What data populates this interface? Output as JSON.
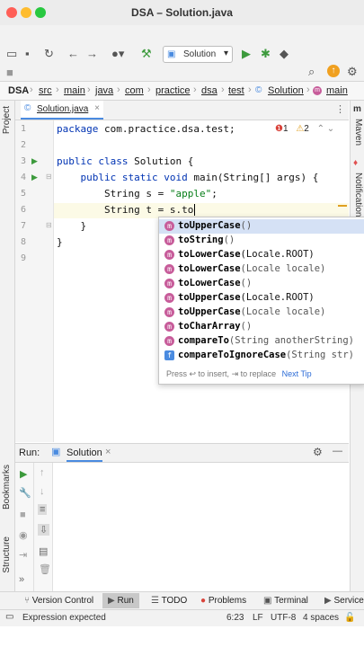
{
  "window": {
    "title": "DSA – Solution.java"
  },
  "toolbar": {
    "run_config": "Solution"
  },
  "breadcrumb": [
    "DSA",
    "src",
    "main",
    "java",
    "com",
    "practice",
    "dsa",
    "test",
    "Solution",
    "main"
  ],
  "left_strip": {
    "project": "Project",
    "bookmarks": "Bookmarks",
    "structure": "Structure"
  },
  "right_strip": {
    "maven": "Maven",
    "notifications": "Notifications"
  },
  "editor": {
    "tab": "Solution.java",
    "line_numbers": [
      "1",
      "2",
      "3",
      "4",
      "5",
      "6",
      "7",
      "8",
      "9"
    ],
    "lines": [
      {
        "kw": "package",
        "rest": " com.practice.dsa.test;"
      },
      {
        "kw": "",
        "rest": ""
      },
      {
        "kw": "public class",
        "rest": " Solution {"
      },
      {
        "kw": "    public static void",
        "rest": " main(String[] args) {"
      },
      {
        "kw": "",
        "rest": "        String s = ",
        "str": "\"apple\"",
        "tail": ";"
      },
      {
        "kw": "",
        "rest": "        String t = s.to"
      },
      {
        "kw": "",
        "rest": "    }"
      },
      {
        "kw": "",
        "rest": "}"
      },
      {
        "kw": "",
        "rest": ""
      }
    ],
    "errors": "1",
    "warnings": "2"
  },
  "completion": {
    "items": [
      {
        "name": "toUpperCase",
        "params": "()",
        "icon": "m"
      },
      {
        "name": "toString",
        "params": "()",
        "icon": "m"
      },
      {
        "name": "toLowerCase",
        "params": "(Locale.ROOT)",
        "icon": "m"
      },
      {
        "name": "toLowerCase",
        "params": "(Locale locale)",
        "icon": "m"
      },
      {
        "name": "toLowerCase",
        "params": "()",
        "icon": "m"
      },
      {
        "name": "toUpperCase",
        "params": "(Locale.ROOT)",
        "icon": "m"
      },
      {
        "name": "toUpperCase",
        "params": "(Locale locale)",
        "icon": "m"
      },
      {
        "name": "toCharArray",
        "params": "()",
        "icon": "m"
      },
      {
        "name": "compareTo",
        "params": "(String anotherString)",
        "icon": "m"
      },
      {
        "name": "compareToIgnoreCase",
        "params": "(String str)",
        "icon": "f"
      }
    ],
    "footer": "Press ↩ to insert, ⇥ to replace",
    "next_tip": "Next Tip"
  },
  "run_panel": {
    "label": "Run:",
    "tab": "Solution"
  },
  "bottom_tabs": [
    "Version Control",
    "Run",
    "TODO",
    "Problems",
    "Terminal",
    "Service"
  ],
  "status": {
    "message": "Expression expected",
    "position": "6:23",
    "line_sep": "LF",
    "encoding": "UTF-8",
    "indent": "4 spaces"
  },
  "colors": {
    "accent": "#4a8be0",
    "run_green": "#3c9a3c",
    "method_icon": "#c75c9a"
  }
}
